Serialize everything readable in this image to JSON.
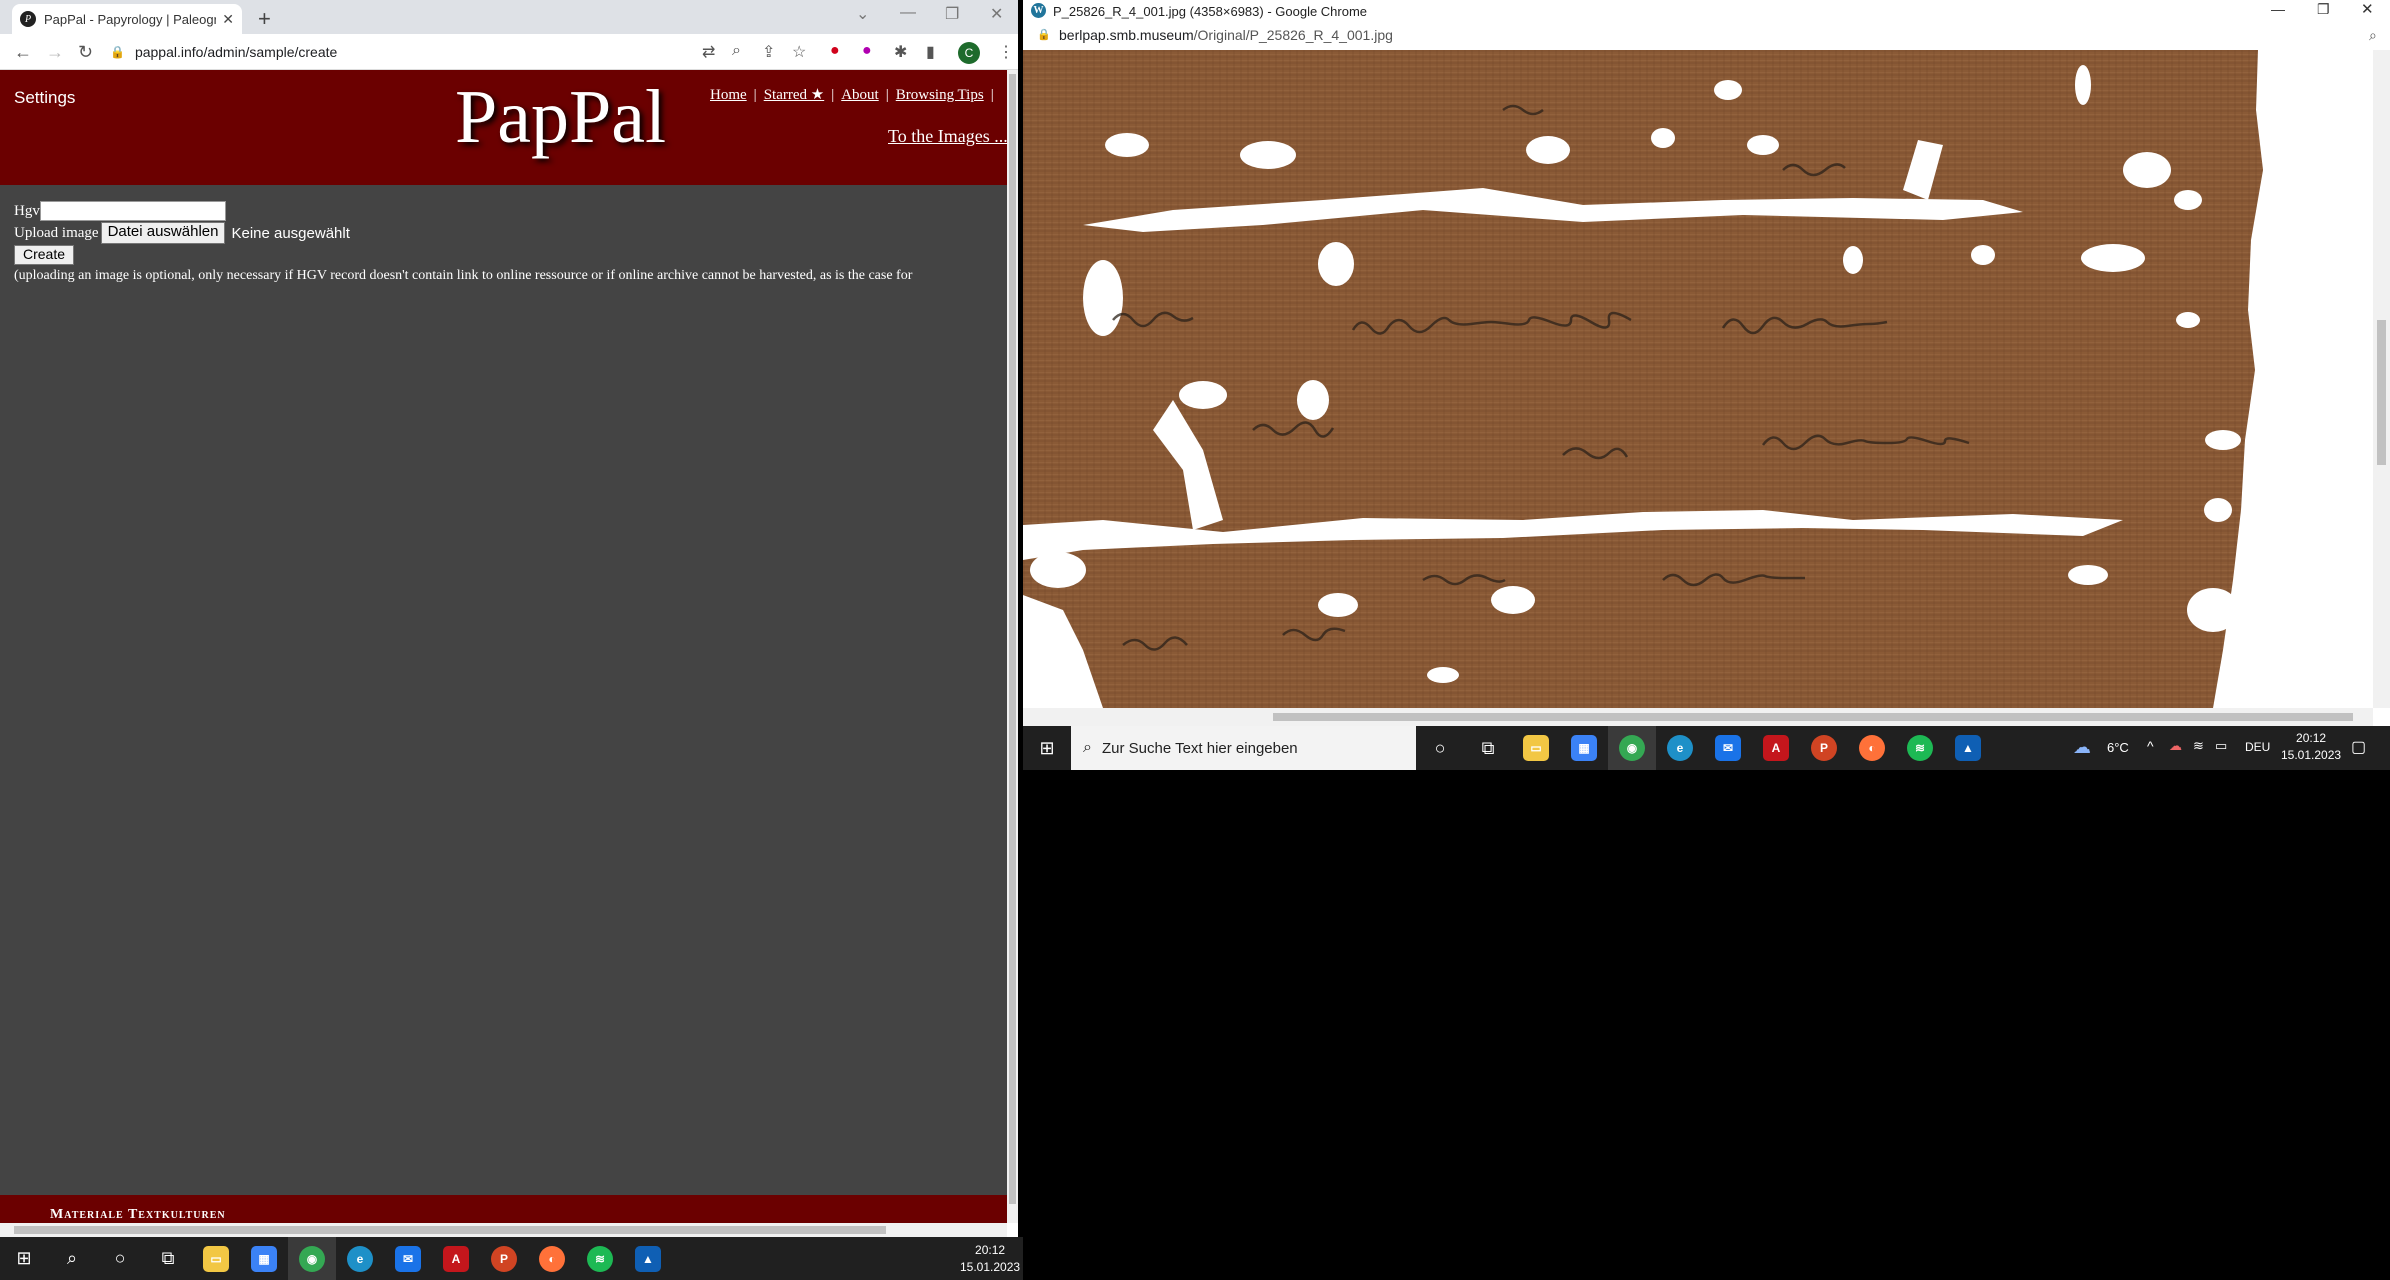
{
  "left_browser": {
    "tab_title": "PapPal - Papyrology | Paleograph",
    "url": "pappal.info/admin/sample/create",
    "profile_initial": "C"
  },
  "site": {
    "settings_label": "Settings",
    "logo": "PapPal",
    "nav": [
      "Home",
      "Starred ★",
      "About",
      "Browsing Tips"
    ],
    "to_images": "To the Images ...",
    "footer_text": "Materiale Textkulturen"
  },
  "form": {
    "hgv_label": "Hgv",
    "hgv_value": "",
    "upload_label": "Upload image",
    "file_button": "Datei auswählen",
    "file_status": "Keine ausgewählt",
    "create_button": "Create",
    "note": "(uploading an image is optional, only necessary if HGV record doesn't contain link to online ressource or if online archive cannot be harvested, as is the case for"
  },
  "right_browser": {
    "window_title": "P_25826_R_4_001.jpg (4358×6983) - Google Chrome",
    "url_domain": "berlpap.smb.museum",
    "url_path": "/Original/P_25826_R_4_001.jpg"
  },
  "taskbar_left": {
    "time": "20:12",
    "date": "15.01.2023"
  },
  "taskbar_right": {
    "search_placeholder": "Zur Suche Text hier eingeben",
    "weather": "6°C",
    "language": "DEU",
    "time": "20:12",
    "date": "15.01.2023"
  },
  "colors": {
    "header_red": "#6b0000",
    "page_bg": "#444444",
    "papyrus": "#8a5a36"
  }
}
